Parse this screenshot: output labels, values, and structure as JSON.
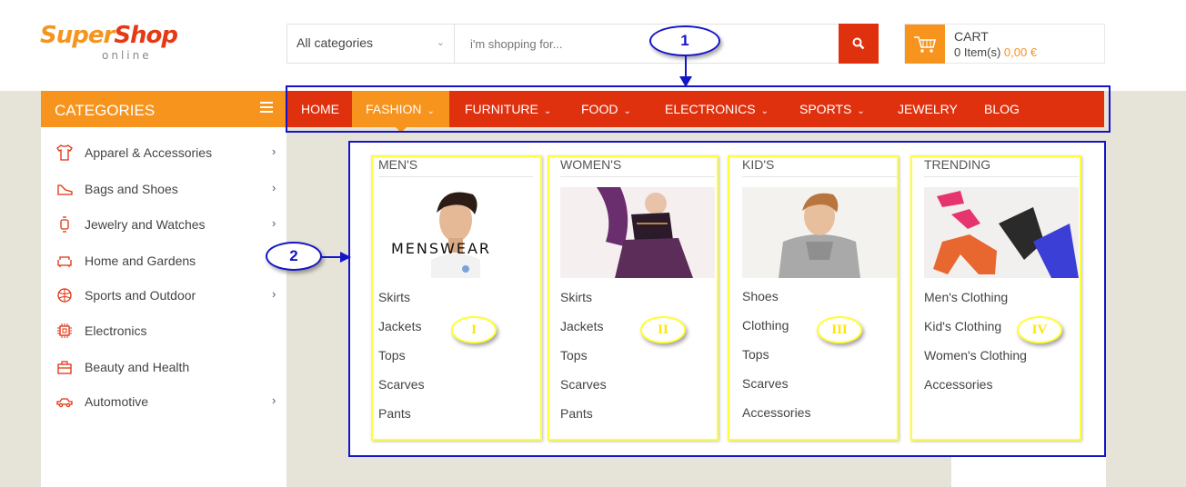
{
  "brand": {
    "logo_super": "Super",
    "logo_shop": "Shop",
    "logo_sub": "online"
  },
  "search": {
    "category": "All categories",
    "placeholder": "i'm shopping for...",
    "button_icon": "search-icon"
  },
  "cart": {
    "label": "CART",
    "items_text": "0 Item(s)",
    "total": "0,00 €",
    "icon": "cart-icon"
  },
  "sidebar": {
    "title": "CATEGORIES",
    "items": [
      {
        "label": "Apparel & Accessories",
        "icon": "tshirt-icon",
        "has_sub": true
      },
      {
        "label": "Bags and Shoes",
        "icon": "shoe-icon",
        "has_sub": true
      },
      {
        "label": "Jewelry and Watches",
        "icon": "watch-icon",
        "has_sub": true
      },
      {
        "label": "Home and Gardens",
        "icon": "sofa-icon",
        "has_sub": false
      },
      {
        "label": "Sports and Outdoor",
        "icon": "ball-icon",
        "has_sub": true
      },
      {
        "label": "Electronics",
        "icon": "chip-icon",
        "has_sub": false
      },
      {
        "label": "Beauty and Health",
        "icon": "bag-icon",
        "has_sub": false
      },
      {
        "label": "Automotive",
        "icon": "car-icon",
        "has_sub": true
      }
    ]
  },
  "nav": {
    "items": [
      {
        "label": "HOME",
        "dropdown": false,
        "active": false
      },
      {
        "label": "FASHION",
        "dropdown": true,
        "active": true
      },
      {
        "label": "FURNITURE",
        "dropdown": true,
        "active": false
      },
      {
        "label": "FOOD",
        "dropdown": true,
        "active": false
      },
      {
        "label": "ELECTRONICS",
        "dropdown": true,
        "active": false
      },
      {
        "label": "SPORTS",
        "dropdown": true,
        "active": false
      },
      {
        "label": "JEWELRY",
        "dropdown": false,
        "active": false
      },
      {
        "label": "BLOG",
        "dropdown": false,
        "active": false
      }
    ]
  },
  "mega_menu": {
    "columns": [
      {
        "title": "MEN'S",
        "image_text": "MENSWEAR",
        "links": [
          "Skirts",
          "Jackets",
          "Tops",
          "Scarves",
          "Pants"
        ],
        "marker": "I"
      },
      {
        "title": "WOMEN'S",
        "links": [
          "Skirts",
          "Jackets",
          "Tops",
          "Scarves",
          "Pants"
        ],
        "marker": "II"
      },
      {
        "title": "KID'S",
        "links": [
          "Shoes",
          "Clothing",
          "Tops",
          "Scarves",
          "Accessories"
        ],
        "marker": "III"
      },
      {
        "title": "TRENDING",
        "links": [
          "Men's Clothing",
          "Kid's Clothing",
          "Women's Clothing",
          "Accessories"
        ],
        "marker": "IV"
      }
    ]
  },
  "annotations": {
    "label_1": "1",
    "label_2": "2",
    "box_color": "#1515c8",
    "column_box_color": "#ffff33"
  },
  "colors": {
    "primary_red": "#e0310f",
    "accent_orange": "#f7941d",
    "page_bg": "#e6e3d9"
  }
}
